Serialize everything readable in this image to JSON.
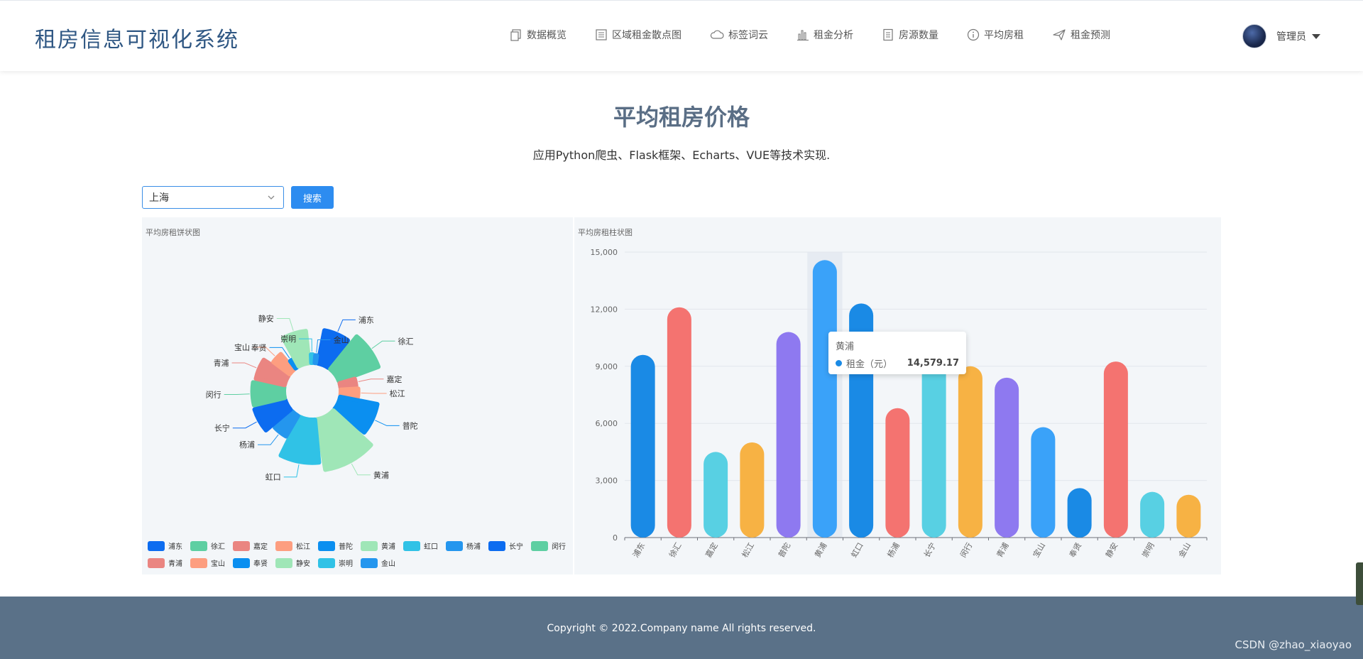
{
  "app": {
    "title": "租房信息可视化系统"
  },
  "nav": [
    {
      "label": "数据概览",
      "icon": "copy-icon"
    },
    {
      "label": "区域租金散点图",
      "icon": "list-icon"
    },
    {
      "label": "标签词云",
      "icon": "cloud-icon"
    },
    {
      "label": "租金分析",
      "icon": "bar-chart-icon"
    },
    {
      "label": "房源数量",
      "icon": "document-icon"
    },
    {
      "label": "平均房租",
      "icon": "info-icon"
    },
    {
      "label": "租金预测",
      "icon": "send-icon"
    }
  ],
  "user": {
    "name": "管理员"
  },
  "page": {
    "title": "平均租房价格",
    "subtitle": "应用Python爬虫、Flask框架、Echarts、VUE等技术实现."
  },
  "filter": {
    "city": "上海",
    "search_label": "搜索"
  },
  "colors": {
    "palette": [
      "#1a8ae5",
      "#f47370",
      "#58d0e3",
      "#f7b244",
      "#8e79f0",
      "#3aa2f9"
    ],
    "primary": "#2d8cf0",
    "footer": "#5a7188"
  },
  "chart_data": [
    {
      "type": "pie",
      "subtype": "rose",
      "title": "平均房租饼状图",
      "categories": [
        "浦东",
        "徐汇",
        "嘉定",
        "松江",
        "普陀",
        "黄浦",
        "虹口",
        "杨浦",
        "长宁",
        "闵行",
        "青浦",
        "宝山",
        "奉贤",
        "静安",
        "崇明",
        "金山"
      ],
      "values": [
        9600,
        12000,
        4500,
        5000,
        10800,
        14579.17,
        12300,
        6800,
        9200,
        9000,
        8400,
        5800,
        2600,
        9200,
        2400,
        2200
      ],
      "colors": [
        "#0c6cf0",
        "#5ecfa2",
        "#ea8581",
        "#fd9e80",
        "#0b8ff0",
        "#9fe6b7",
        "#30c2e6",
        "#2496ee",
        "#0c6cf0",
        "#5ecfa2",
        "#ea8581",
        "#fd9e80",
        "#0b8ff0",
        "#9fe6b7",
        "#30c2e6",
        "#2496ee"
      ],
      "legend": "bottom"
    },
    {
      "type": "bar",
      "title": "平均房租柱状图",
      "categories": [
        "浦东",
        "徐汇",
        "嘉定",
        "松江",
        "普陀",
        "黄浦",
        "虹口",
        "杨浦",
        "长宁",
        "闵行",
        "青浦",
        "宝山",
        "奉贤",
        "静安",
        "崇明",
        "金山"
      ],
      "series": [
        {
          "name": "租金（元）",
          "values": [
            9600,
            12100,
            4500,
            5000,
            10800,
            14579.17,
            12300,
            6800,
            9200,
            9000,
            8400,
            5800,
            2600,
            9250,
            2400,
            2250
          ]
        }
      ],
      "ylim": [
        0,
        15000
      ],
      "yticks": [
        "0",
        "3,000",
        "6,000",
        "9,000",
        "12,000",
        "15,000"
      ],
      "grid": true,
      "tooltip": {
        "title": "黄浦",
        "label": "租金（元）",
        "value": "14,579.17"
      }
    }
  ],
  "footer": {
    "copyright": "Copyright © 2022.Company name All rights reserved."
  },
  "watermark": "CSDN @zhao_xiaoyao"
}
